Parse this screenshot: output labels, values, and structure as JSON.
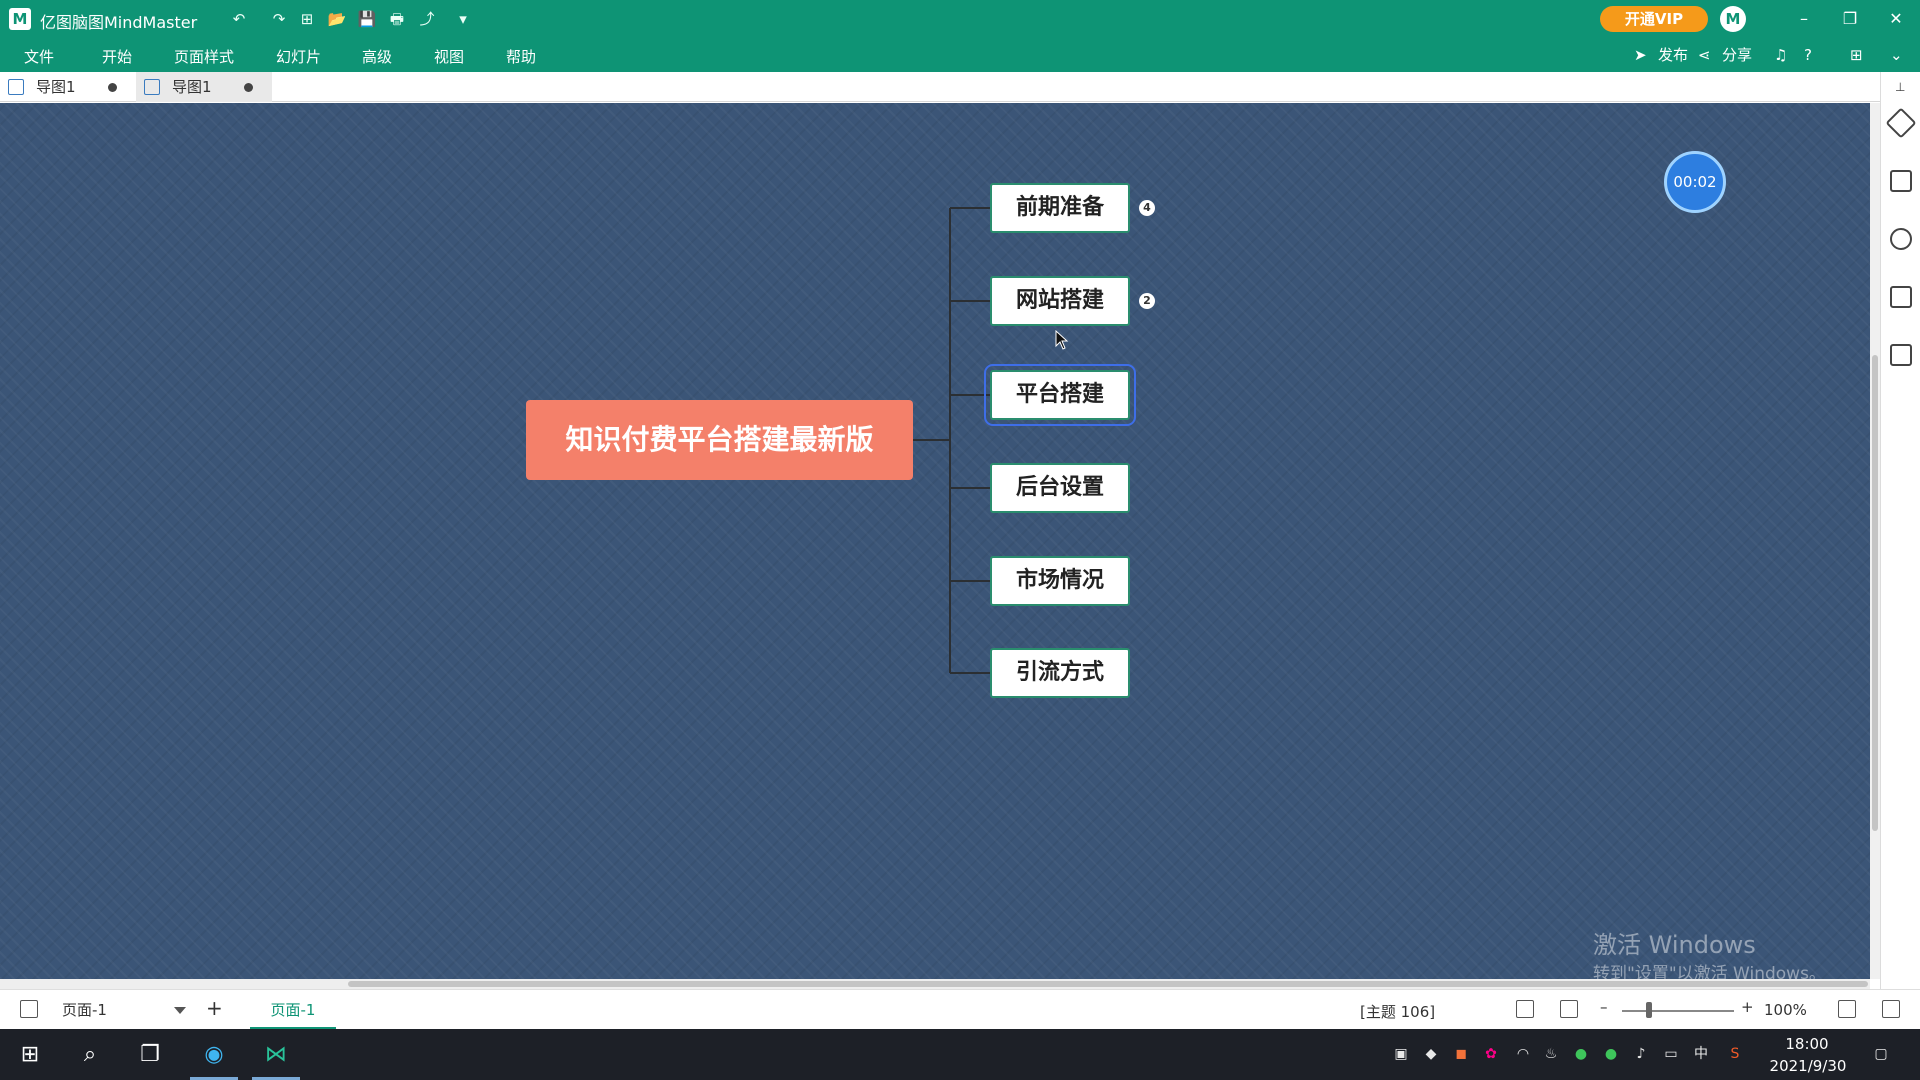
{
  "app": {
    "title": "亿图脑图MindMaster",
    "logo": "M",
    "vip_label": "开通VIP",
    "avatar_letter": "M",
    "window_controls": [
      "–",
      "❐",
      "✕"
    ]
  },
  "quick_access": [
    "↶",
    "↷",
    "⊞",
    "📂",
    "💾",
    "🖶",
    "⤴",
    "▾"
  ],
  "menu": {
    "items": [
      "文件",
      "开始",
      "页面样式",
      "幻灯片",
      "高级",
      "视图",
      "帮助"
    ],
    "publish": "发布",
    "share": "分享"
  },
  "doc_tabs": [
    {
      "label": "导图1",
      "active": false
    },
    {
      "label": "导图1",
      "active": true
    }
  ],
  "mindmap": {
    "central": "知识付费平台搭建最新版",
    "topics": [
      {
        "label": "前期准备",
        "badge": "4"
      },
      {
        "label": "网站搭建",
        "badge": "2"
      },
      {
        "label": "平台搭建",
        "badge": null,
        "selected": true
      },
      {
        "label": "后台设置",
        "badge": null
      },
      {
        "label": "市场情况",
        "badge": null
      },
      {
        "label": "引流方式",
        "badge": null
      }
    ],
    "colors": {
      "central": "#f4806a",
      "topic_border": "#2a8d6e",
      "canvas": "#3b5577",
      "selection": "#3e6ee8"
    }
  },
  "timer": "00:02",
  "watermark": {
    "line1": "激活 Windows",
    "line2": "转到\"设置\"以激活 Windows。"
  },
  "status": {
    "page_select": "页面-1",
    "page_tab": "页面-1",
    "add": "+",
    "topic_count": "[主题 106]",
    "zoom_minus": "–",
    "zoom_plus": "+",
    "zoom": "100%"
  },
  "taskbar": {
    "time": "18:00",
    "date": "2021/9/30",
    "ime": "中"
  }
}
